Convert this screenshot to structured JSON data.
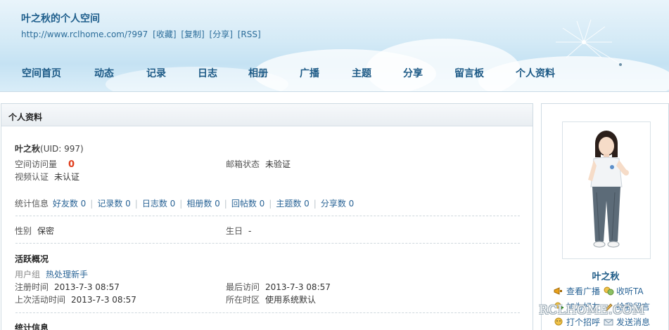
{
  "header": {
    "title": "叶之秋的个人空间",
    "url": "http://www.rclhome.com/?997",
    "links": [
      "[收藏]",
      "[复制]",
      "[分享]",
      "[RSS]"
    ]
  },
  "nav": {
    "items": [
      "空间首页",
      "动态",
      "记录",
      "日志",
      "相册",
      "广播",
      "主题",
      "分享",
      "留言板",
      "个人资料"
    ]
  },
  "profile": {
    "panel_title": "个人资料",
    "name": "叶之秋",
    "uid": "(UID: 997)",
    "visits_label": "空间访问量",
    "visits_value": "0",
    "email_label": "邮箱状态",
    "email_value": "未验证",
    "video_label": "视频认证",
    "video_value": "未认证",
    "stats_label": "统计信息",
    "stats": [
      "好友数 0",
      "记录数 0",
      "日志数 0",
      "相册数 0",
      "回帖数 0",
      "主题数 0",
      "分享数 0"
    ],
    "gender_label": "性别",
    "gender_value": "保密",
    "birthday_label": "生日",
    "birthday_value": "-",
    "activity_title": "活跃概况",
    "group_label": "用户组",
    "group_value": "热处理新手",
    "register_label": "注册时间",
    "register_value": "2013-7-3 08:57",
    "last_visit_label": "最后访问",
    "last_visit_value": "2013-7-3 08:57",
    "last_active_label": "上次活动时间",
    "last_active_value": "2013-7-3 08:57",
    "timezone_label": "所在时区",
    "timezone_value": "使用系统默认",
    "stats_title": "统计信息"
  },
  "sidebar": {
    "name": "叶之秋",
    "actions": [
      "查看广播",
      "收听TA",
      "加为好友",
      "给我留言",
      "打个招呼",
      "发送消息"
    ]
  },
  "watermark": "RCLHOME.COM"
}
